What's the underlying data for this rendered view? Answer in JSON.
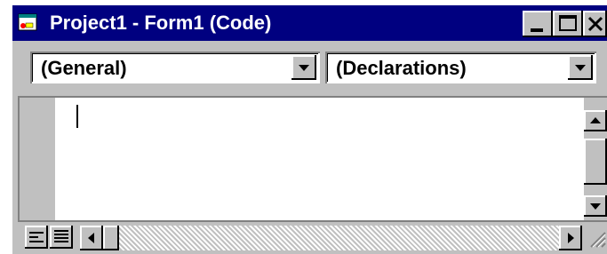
{
  "window": {
    "title": "Project1 - Form1 (Code)",
    "title_bar_color": "#000080",
    "face_color": "#c0c0c0"
  },
  "titlebar_icons": {
    "app": "form-icon",
    "minimize": "minimize-icon",
    "maximize": "maximize-icon",
    "close": "close-icon"
  },
  "object_combo": {
    "value": "(General)"
  },
  "procedure_combo": {
    "value": "(Declarations)"
  },
  "editor": {
    "code_text": ""
  },
  "view_buttons": {
    "procedure_view": "procedure-view-icon",
    "full_module_view": "full-module-view-icon"
  }
}
